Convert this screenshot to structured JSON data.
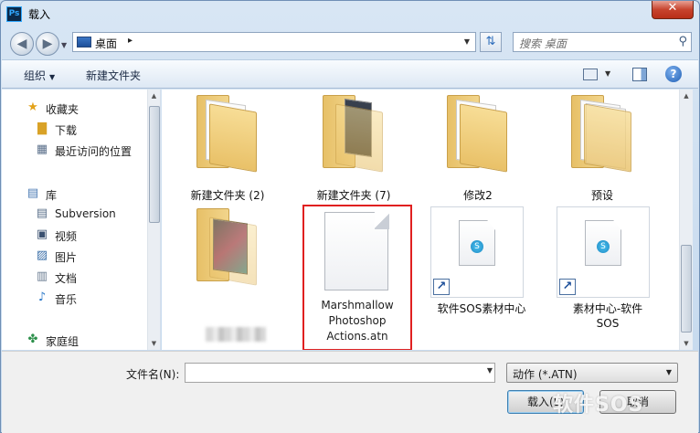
{
  "window": {
    "title": "载入",
    "app_icon_text": "Ps",
    "close_glyph": "✕"
  },
  "address": {
    "location": "桌面",
    "separator": "▸",
    "search_placeholder": "搜索 桌面"
  },
  "toolbar": {
    "organize": "组织",
    "new_folder": "新建文件夹",
    "help": "?"
  },
  "sidebar": {
    "favorites": "收藏夹",
    "downloads": "下载",
    "recent": "最近访问的位置",
    "libraries": "库",
    "subversion": "Subversion",
    "videos": "视频",
    "pictures": "图片",
    "documents": "文档",
    "music": "音乐",
    "homegroup": "家庭组"
  },
  "files": [
    {
      "name": "新建文件夹 (2)",
      "type": "folder"
    },
    {
      "name": "新建文件夹 (7)",
      "type": "folder"
    },
    {
      "name": "修改2",
      "type": "folder"
    },
    {
      "name": "预设",
      "type": "folder"
    },
    {
      "name": "",
      "type": "folder"
    },
    {
      "name": "Marshmallow Photoshop Actions.atn",
      "line1": "Marshmallow",
      "line2": "Photoshop",
      "line3": "Actions.atn",
      "type": "atn",
      "selected": true
    },
    {
      "name": "软件SOS素材中心",
      "type": "shortcut"
    },
    {
      "name": "素材中心-软件SOS",
      "line1": "素材中心-软件",
      "line2": "SOS",
      "type": "shortcut"
    }
  ],
  "bottom": {
    "filename_label": "文件名(N):",
    "filename_value": "",
    "filetype": "动作 (*.ATN)",
    "open_button": "载入(L)",
    "cancel_button": "取消"
  },
  "watermark": "软件SOS",
  "icons": {
    "back": "back-arrow-icon",
    "forward": "forward-arrow-icon",
    "refresh": "refresh-icon",
    "search": "search-icon",
    "star": "star-icon",
    "folder": "folder-icon"
  }
}
